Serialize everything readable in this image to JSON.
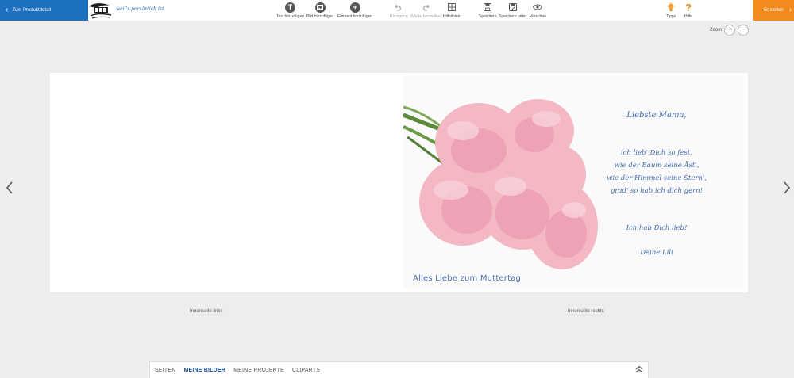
{
  "header": {
    "back_label": "Zum Produktdetail",
    "slogan": "weil's persönlich ist",
    "order_label": "Bestellen",
    "colors": {
      "primary": "#1d6fc0",
      "accent": "#f28a1c"
    }
  },
  "toolbar": {
    "tools": [
      {
        "label": "Text hinzufügen",
        "icon": "text-icon"
      },
      {
        "label": "Bild hinzufügen",
        "icon": "image-icon"
      },
      {
        "label": "Element hinzufügen",
        "icon": "plus-icon"
      },
      {
        "label": "Rückgäng",
        "icon": "undo-icon",
        "disabled": true
      },
      {
        "label": "Wiederherstellen",
        "icon": "redo-icon",
        "disabled": true
      },
      {
        "label": "Hilfslinien",
        "icon": "grid-icon"
      },
      {
        "label": "Speichern",
        "icon": "save-icon"
      },
      {
        "label": "Speichern unter",
        "icon": "save-as-icon"
      },
      {
        "label": "Vorschau",
        "icon": "eye-icon"
      }
    ],
    "tips_label": "Tipps",
    "help_label": "Hilfe"
  },
  "zoom": {
    "label": "Zoom",
    "plus": "+",
    "minus": "−"
  },
  "card": {
    "greeting": {
      "line1": "Liebste Mama,",
      "line2": "ich lieb' Dich so fest,",
      "line3": "wie der Baum seine Äst',",
      "line4": "wie der Himmel seine Stern',",
      "line5": "grad' so hab ich dich gern!",
      "line6": "Ich hab Dich lieb!",
      "line7": "Deine Lili"
    },
    "caption": "Alles Liebe zum Muttertag"
  },
  "pages": {
    "left_label": "Innenseite links",
    "right_label": "Innenseite rechts"
  },
  "bottom_tabs": [
    {
      "label": "SEITEN",
      "active": false
    },
    {
      "label": "MEINE BILDER",
      "active": true
    },
    {
      "label": "MEINE PROJEKTE",
      "active": false
    },
    {
      "label": "CLIPARTS",
      "active": false
    }
  ]
}
